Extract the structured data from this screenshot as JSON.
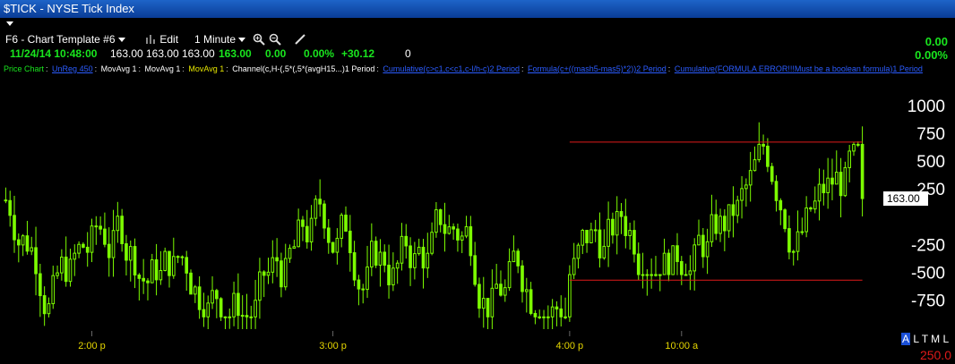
{
  "window": {
    "title": "$TICK - NYSE Tick Index"
  },
  "toolbar": {
    "template": "F6 - Chart Template #6",
    "edit": "Edit",
    "interval": "1 Minute"
  },
  "quote": {
    "datetime": "11/24/14 10:48:00",
    "v1": "163.00",
    "v2": "163.00",
    "v3": "163.00",
    "last": "163.00",
    "change": "0.00",
    "pct": "0.00%",
    "v4": "+30.12",
    "volume": "0",
    "right_change": "0.00",
    "right_pct": "0.00%"
  },
  "studies": {
    "price_chart": "Price Chart",
    "unreg": "UnReg 450",
    "mov1": "MovAvg 1",
    "mov2": "MovAvg 1",
    "mov3": "MovAvg 1",
    "channel": "Channel(c,H-(,5*(,5*(avgH15...)1 Period",
    "cum1": "Cumulative(c>c1,c<c1,c-l/h-c)2 Period",
    "formula": "Formula(c+((mash5-mas5)*2))2 Period",
    "cum2": "Cumulative(FORMULA ERROR!!!Must be a boolean formula)1 Period"
  },
  "bottom": {
    "a": "A",
    "ltml": "L T M L",
    "scale_value": "250.0"
  },
  "colors": {
    "candle": "#7cfc00",
    "channel": "#e01a1a",
    "axis_label": "#ffffff",
    "time_label": "#e6d700",
    "background": "#000000"
  },
  "chart_data": {
    "type": "candlestick",
    "title": "$TICK - NYSE Tick Index",
    "y_ticks": [
      1000,
      750,
      500,
      250,
      -250,
      -500,
      -750
    ],
    "y_tick_labels": [
      "1000",
      "750",
      "500",
      "250",
      "-250",
      "-500",
      "-750"
    ],
    "ylim": [
      -1010,
      1240
    ],
    "x_tick_labels": [
      "2:00 p",
      "3:00 p",
      "4:00 p",
      "10:00 a"
    ],
    "x_tick_index": [
      20,
      76,
      131,
      157
    ],
    "n_bars": 200,
    "session_break_index": 131,
    "last_value": "163.00",
    "channel": {
      "start_index": 131,
      "end_index": 199,
      "upper": 670,
      "lower": -570
    },
    "grid": false
  }
}
